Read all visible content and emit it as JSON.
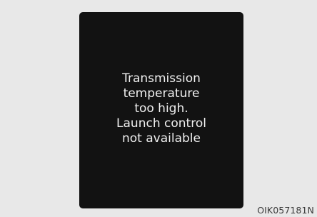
{
  "display": {
    "message_lines": [
      "Transmission",
      "temperature",
      "too high.",
      "Launch control",
      "not available"
    ]
  },
  "figure_code": "OIK057181N",
  "colors": {
    "page_background": "#e8e8e8",
    "screen_background": "#121212",
    "text": "#f0f0f0"
  }
}
